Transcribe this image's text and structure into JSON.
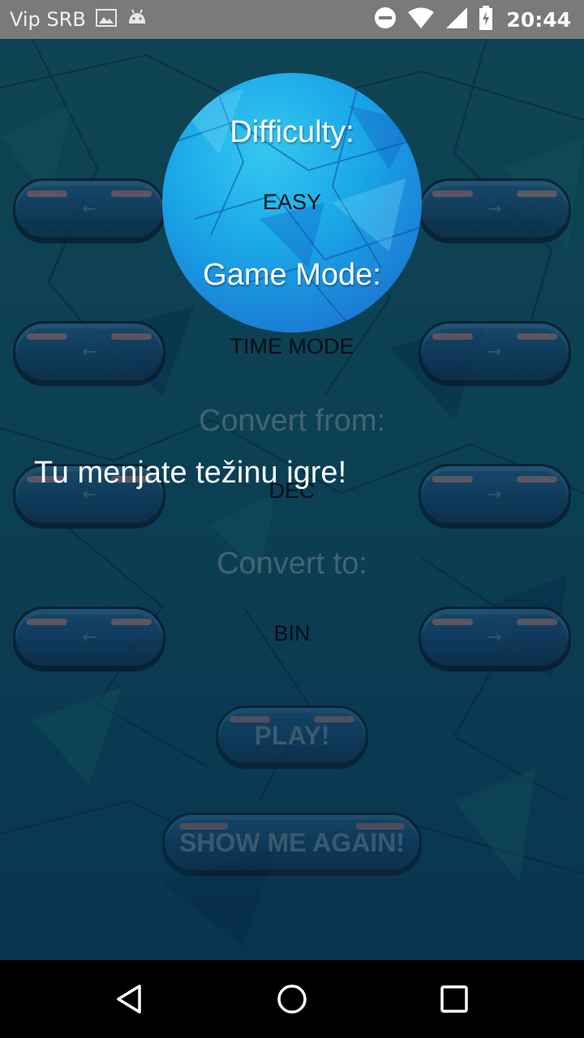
{
  "status_bar": {
    "carrier": "Vip SRB",
    "time": "20:44",
    "icons": [
      "image-icon",
      "android-icon",
      "do-not-disturb-icon",
      "wifi-icon",
      "signal-icon",
      "battery-charging-icon"
    ]
  },
  "screen": {
    "difficulty_label": "Difficulty:",
    "difficulty_value": "EASY",
    "game_mode_label": "Game Mode:",
    "game_mode_value": "TIME MODE",
    "convert_from_label": "Convert from:",
    "convert_from_value": "DEC",
    "convert_to_label": "Convert to:",
    "convert_to_value": "BIN",
    "arrow_left": "←",
    "arrow_right": "→",
    "play_label": "PLAY!",
    "show_again_label": "SHOW ME AGAIN!"
  },
  "showcase": {
    "hint": "Tu menjate težinu igre!"
  },
  "nav_bar": {
    "icons": [
      "back-icon",
      "home-icon",
      "recents-icon"
    ]
  },
  "colors": {
    "background": "#0f4f62",
    "spotlight": "#1aa8e8",
    "button": "#1d4f7f",
    "button_highlight": "#c98c8c"
  }
}
